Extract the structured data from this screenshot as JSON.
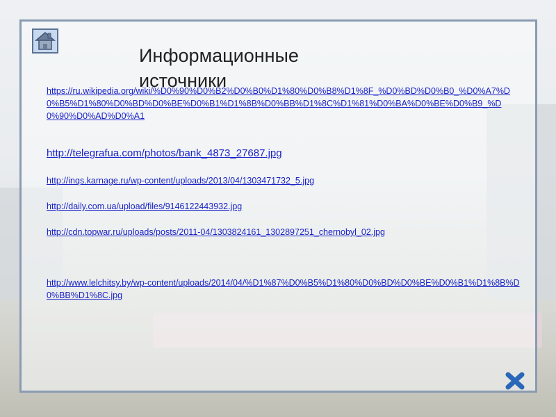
{
  "title": "Информационные источники",
  "links": [
    "https://ru.wikipedia.org/wiki/%D0%90%D0%B2%D0%B0%D1%80%D0%B8%D1%8F_%D0%BD%D0%B0_%D0%A7%D0%B5%D1%80%D0%BD%D0%BE%D0%B1%D1%8B%D0%BB%D1%8C%D1%81%D0%BA%D0%BE%D0%B9_%D0%90%D0%AD%D0%A1",
    "http://telegrafua.com/photos/bank_4873_27687.jpg",
    "http://inqs.karnage.ru/wp-content/uploads/2013/04/1303471732_5.jpg",
    "http://daily.com.ua/upload/files/9146122443932.jpg",
    "http://cdn.topwar.ru/uploads/posts/2011-04/1303824161_1302897251_chernobyl_02.jpg",
    "http://www.lelchitsy.by/wp-content/uploads/2014/04/%D1%87%D0%B5%D1%80%D0%BD%D0%BE%D0%B1%D1%8B%D0%BB%D1%8C.jpg"
  ],
  "colors": {
    "link": "#1a23c8",
    "frame": "#8a9bb2",
    "close": "#2b67b8"
  }
}
